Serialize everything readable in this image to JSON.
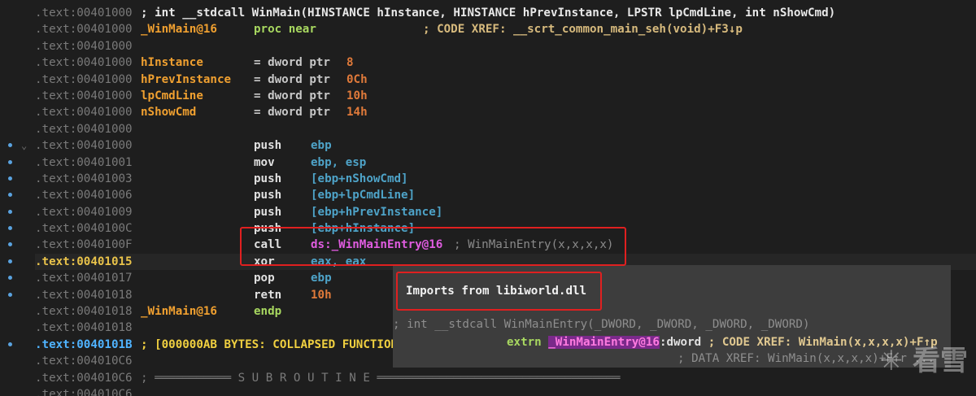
{
  "listing": {
    "header_comment": "; int __stdcall WinMain(HINSTANCE hInstance, HINSTANCE hPrevInstance, LPSTR lpCmdLine, int nShowCmd)",
    "proc_label": "_WinMain@16",
    "proc_kw": "proc near",
    "proc_xref": "; CODE XREF: __scrt_common_main_seh(void)+F3↓p",
    "args": [
      {
        "name": "hInstance",
        "value": "8"
      },
      {
        "name": "hPrevInstance",
        "value": "0Ch"
      },
      {
        "name": "lpCmdLine",
        "value": "10h"
      },
      {
        "name": "nShowCmd",
        "value": "14h"
      }
    ],
    "arg_type": "= dword ptr",
    "instructions": [
      {
        "addr": ".text:00401000",
        "mnem": "push",
        "op": "ebp"
      },
      {
        "addr": ".text:00401001",
        "mnem": "mov",
        "op": "ebp, esp"
      },
      {
        "addr": ".text:00401003",
        "mnem": "push",
        "op": "[ebp+nShowCmd]"
      },
      {
        "addr": ".text:00401006",
        "mnem": "push",
        "op": "[ebp+lpCmdLine]"
      },
      {
        "addr": ".text:00401009",
        "mnem": "push",
        "op": "[ebp+hPrevInstance]"
      },
      {
        "addr": ".text:0040100C",
        "mnem": "push",
        "op": "[ebp+hInstance]"
      },
      {
        "addr": ".text:0040100F",
        "mnem": "call",
        "op": "ds:_WinMainEntry@16",
        "comment": "; WinMainEntry(x,x,x,x)"
      },
      {
        "addr": ".text:00401015",
        "mnem": "xor",
        "op": "eax, eax"
      },
      {
        "addr": ".text:00401017",
        "mnem": "pop",
        "op": "ebp"
      },
      {
        "addr": ".text:00401018",
        "mnem": "retn",
        "op": "10h"
      }
    ],
    "endp_label": "_WinMain@16",
    "endp_kw": "endp",
    "addresses": [
      ".text:00401000",
      ".text:00401000",
      ".text:00401000",
      ".text:00401000",
      ".text:00401000",
      ".text:00401000",
      ".text:00401000",
      ".text:00401000"
    ],
    "addr_endp": ".text:00401018",
    "addr_blank": ".text:00401018",
    "addr_collapsed": ".text:0040101B",
    "collapsed_text": "; [000000AB BYTES: COLLAPSED FUNCTION",
    "addr_c6a": ".text:004010C6",
    "addr_c6b": ".text:004010C6",
    "subroutine_text": "; ═══════════ S U B R O U T I N E ═══════════════════════════════════",
    "addr_c6c": ".text:004010C6"
  },
  "popup": {
    "title": "Imports from libiworld.dll",
    "proto": "; int __stdcall WinMainEntry(_DWORD, _DWORD, _DWORD, _DWORD)",
    "extrn_kw": "extrn",
    "extrn_name": "_WinMainEntry@16",
    "extrn_type": ":dword",
    "extrn_xref": "; CODE XREF: WinMain(x,x,x,x)+F↑p",
    "data_xref": "; DATA XREF: WinMain(x,x,x,x)+F↑r ..."
  },
  "watermark": "✳ 看雪",
  "colors": {
    "background": "#1e1e1e",
    "highlight_box": "#e02020",
    "popup_bg": "#3d3d3d"
  }
}
